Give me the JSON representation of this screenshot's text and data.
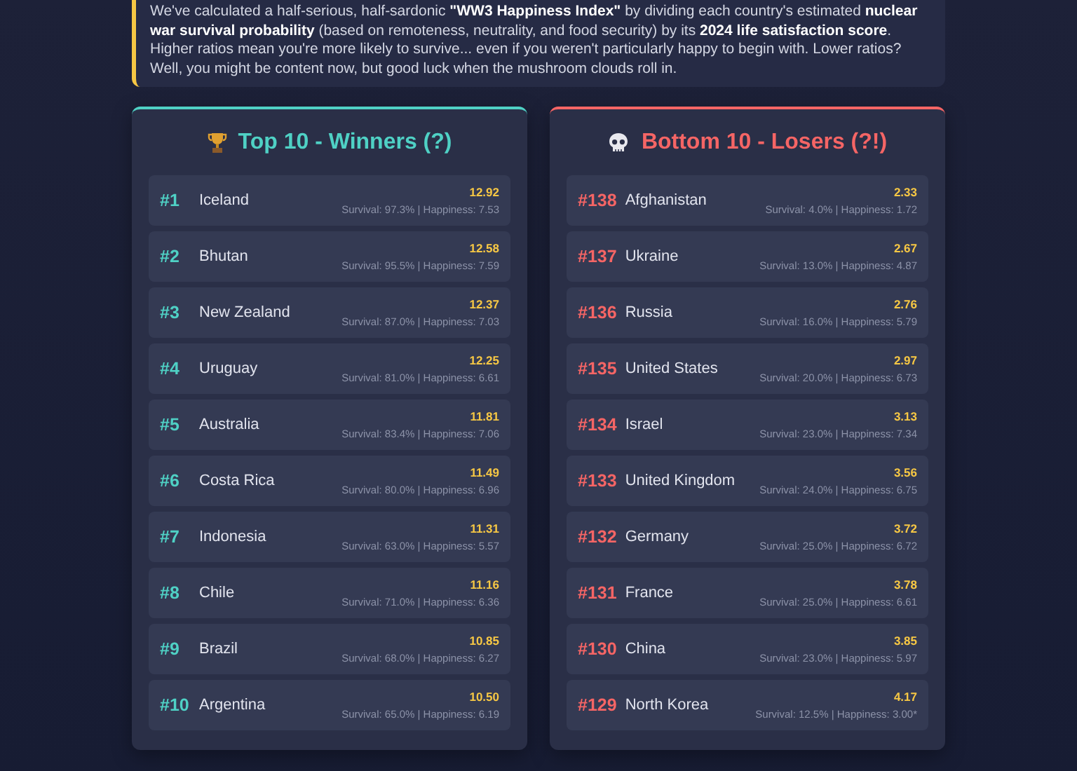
{
  "intro": {
    "text": "We've calculated a half-serious, half-sardonic **\"WW3 Happiness Index\"** by dividing each country's estimated **nuclear war survival probability** (based on remoteness, neutrality, and food security) by its **2024 life satisfaction score**. Higher ratios mean you're more likely to survive... even if you weren't particularly happy to begin with. Lower ratios? Well, you might be content now, but good luck when the mushroom clouds roll in."
  },
  "panels": [
    {
      "kind": "winners",
      "title": "Top 10 - Winners (?)",
      "rows": [
        {
          "rank": "#1",
          "country": "Iceland",
          "ratio": "12.92",
          "stats": "Survival: 97.3% | Happiness: 7.53"
        },
        {
          "rank": "#2",
          "country": "Bhutan",
          "ratio": "12.58",
          "stats": "Survival: 95.5% | Happiness: 7.59"
        },
        {
          "rank": "#3",
          "country": "New Zealand",
          "ratio": "12.37",
          "stats": "Survival: 87.0% | Happiness: 7.03"
        },
        {
          "rank": "#4",
          "country": "Uruguay",
          "ratio": "12.25",
          "stats": "Survival: 81.0% | Happiness: 6.61"
        },
        {
          "rank": "#5",
          "country": "Australia",
          "ratio": "11.81",
          "stats": "Survival: 83.4% | Happiness: 7.06"
        },
        {
          "rank": "#6",
          "country": "Costa Rica",
          "ratio": "11.49",
          "stats": "Survival: 80.0% | Happiness: 6.96"
        },
        {
          "rank": "#7",
          "country": "Indonesia",
          "ratio": "11.31",
          "stats": "Survival: 63.0% | Happiness: 5.57"
        },
        {
          "rank": "#8",
          "country": "Chile",
          "ratio": "11.16",
          "stats": "Survival: 71.0% | Happiness: 6.36"
        },
        {
          "rank": "#9",
          "country": "Brazil",
          "ratio": "10.85",
          "stats": "Survival: 68.0% | Happiness: 6.27"
        },
        {
          "rank": "#10",
          "country": "Argentina",
          "ratio": "10.50",
          "stats": "Survival: 65.0% | Happiness: 6.19"
        }
      ]
    },
    {
      "kind": "losers",
      "title": "Bottom 10 - Losers (?!)",
      "rows": [
        {
          "rank": "#138",
          "country": "Afghanistan",
          "ratio": "2.33",
          "stats": "Survival: 4.0% | Happiness: 1.72"
        },
        {
          "rank": "#137",
          "country": "Ukraine",
          "ratio": "2.67",
          "stats": "Survival: 13.0% | Happiness: 4.87"
        },
        {
          "rank": "#136",
          "country": "Russia",
          "ratio": "2.76",
          "stats": "Survival: 16.0% | Happiness: 5.79"
        },
        {
          "rank": "#135",
          "country": "United States",
          "ratio": "2.97",
          "stats": "Survival: 20.0% | Happiness: 6.73"
        },
        {
          "rank": "#134",
          "country": "Israel",
          "ratio": "3.13",
          "stats": "Survival: 23.0% | Happiness: 7.34"
        },
        {
          "rank": "#133",
          "country": "United Kingdom",
          "ratio": "3.56",
          "stats": "Survival: 24.0% | Happiness: 6.75"
        },
        {
          "rank": "#132",
          "country": "Germany",
          "ratio": "3.72",
          "stats": "Survival: 25.0% | Happiness: 6.72"
        },
        {
          "rank": "#131",
          "country": "France",
          "ratio": "3.78",
          "stats": "Survival: 25.0% | Happiness: 6.61"
        },
        {
          "rank": "#130",
          "country": "China",
          "ratio": "3.85",
          "stats": "Survival: 23.0% | Happiness: 5.97"
        },
        {
          "rank": "#129",
          "country": "North Korea",
          "ratio": "4.17",
          "stats": "Survival: 12.5% | Happiness: 3.00*"
        }
      ]
    }
  ]
}
